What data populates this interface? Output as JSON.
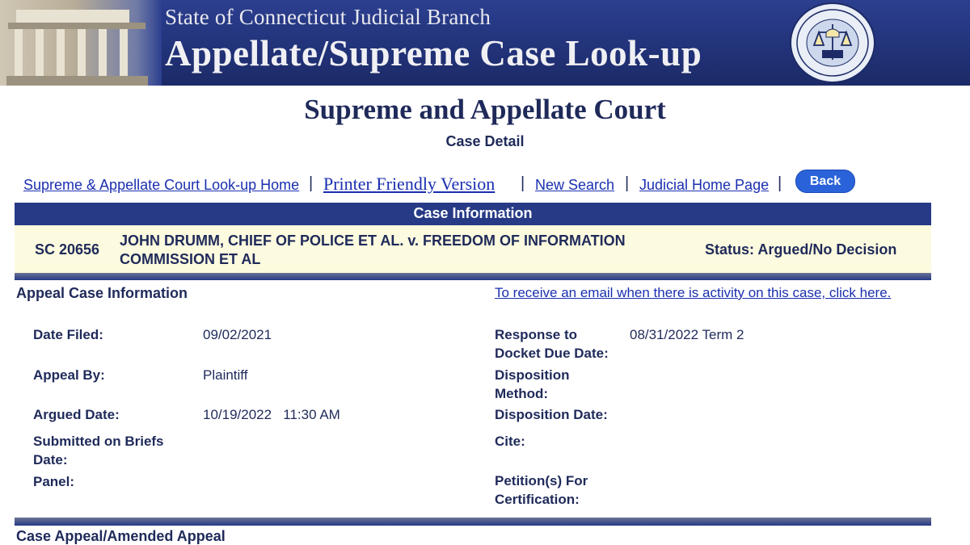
{
  "banner": {
    "line1": "State of Connecticut Judicial Branch",
    "line2": "Appellate/Supreme Case Look-up",
    "seal_text_top": "STATE OF CONNECTICUT",
    "seal_text_bottom": "JUDICIAL BRANCH"
  },
  "page": {
    "title": "Supreme and Appellate Court",
    "subtitle": "Case Detail"
  },
  "nav": {
    "home": "Supreme & Appellate Court Look-up Home",
    "printer": "Printer Friendly Version",
    "new_search": "New Search",
    "judicial_home": "Judicial Home Page",
    "separator": "|",
    "back": "Back"
  },
  "case": {
    "header": "Case Information",
    "number": "SC 20656",
    "name": "JOHN DRUMM, CHIEF OF POLICE ET AL. v. FREEDOM OF INFORMATION COMMISSION ET AL",
    "status": "Status: Argued/No Decision"
  },
  "appeal": {
    "title": "Appeal Case Information",
    "email_link": "To receive an email when there is activity on this case, click here.",
    "left": [
      {
        "label": "Date Filed:",
        "value": "09/02/2021"
      },
      {
        "label": "Appeal By:",
        "value": "Plaintiff"
      },
      {
        "label": "Argued Date:",
        "value": "10/19/2022   11:30 AM"
      },
      {
        "label": "Submitted on Briefs Date:",
        "value": ""
      },
      {
        "label": "Panel:",
        "value": ""
      }
    ],
    "right": [
      {
        "label": "Response to Docket Due Date:",
        "value": "08/31/2022 Term 2"
      },
      {
        "label": "Disposition Method:",
        "value": ""
      },
      {
        "label": "Disposition Date:",
        "value": ""
      },
      {
        "label": "Cite:",
        "value": ""
      },
      {
        "label": "Petition(s) For Certification:",
        "value": ""
      }
    ]
  },
  "next_section": {
    "title": "Case Appeal/Amended Appeal"
  },
  "colors": {
    "banner": "#22337a",
    "header_bar": "#263a85",
    "case_box": "#fdfbdf",
    "link": "#1a2fb0",
    "text": "#1f2a5a",
    "back_button": "#2a63d9"
  }
}
